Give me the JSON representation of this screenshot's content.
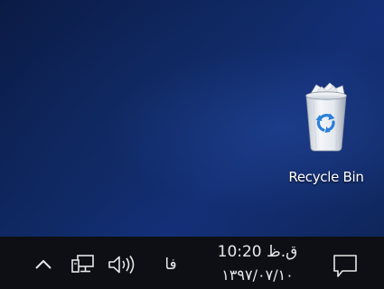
{
  "desktop": {
    "background_color": "#0d1f4a",
    "icons": [
      {
        "label": "Recycle Bin",
        "icon": "recycle-bin-icon"
      }
    ]
  },
  "taskbar": {
    "background_color": "#0e0f14",
    "tray": {
      "overflow_icon": "chevron-up-icon",
      "network_icon": "network-icon",
      "volume_icon": "volume-icon",
      "language": "فا",
      "clock_time": "ق.ظ 10:20",
      "clock_date": "۱۳۹۷/۰۷/۱۰",
      "notification_icon": "action-center-icon"
    }
  }
}
